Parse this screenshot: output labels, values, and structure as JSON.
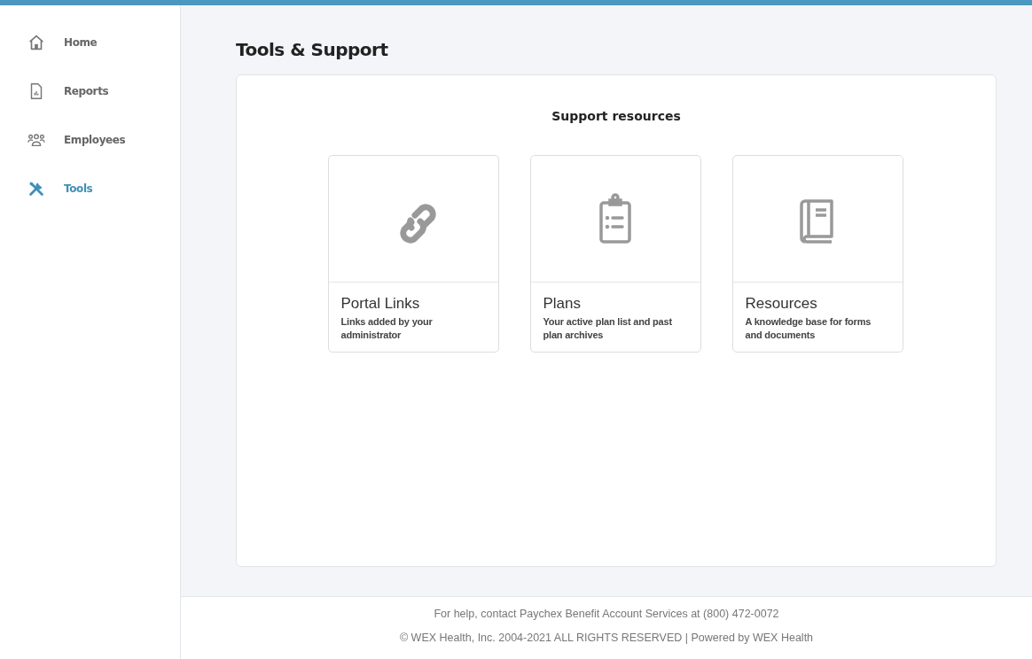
{
  "sidebar": {
    "items": [
      {
        "label": "Home",
        "selected": false
      },
      {
        "label": "Reports",
        "selected": false
      },
      {
        "label": "Employees",
        "selected": false
      },
      {
        "label": "Tools",
        "selected": true
      }
    ]
  },
  "page_title": "Tools & Support",
  "panel": {
    "heading": "Support resources",
    "tiles": [
      {
        "title": "Portal Links",
        "description": "Links added by your administrator"
      },
      {
        "title": "Plans",
        "description": "Your active plan list and past plan archives"
      },
      {
        "title": "Resources",
        "description": "A knowledge base for forms and documents"
      }
    ]
  },
  "footer": {
    "help": "For help, contact Paychex Benefit Account Services at (800) 472-0072",
    "copyright": "© WEX Health, Inc. 2004-2021 ALL RIGHTS RESERVED | Powered by WEX Health"
  }
}
